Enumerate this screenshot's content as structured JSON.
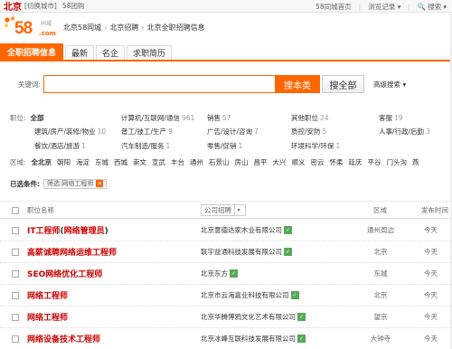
{
  "topbar": {
    "city": "北京",
    "switch_city": "[切换城市]",
    "group": "58团购",
    "home": "58同城首页",
    "history": "浏览记录",
    "search": "搜索"
  },
  "logo": {
    "num": "58",
    "com": ".com",
    "cn": "同城"
  },
  "breadcrumb": [
    "北京58同城",
    "北京招聘",
    "北京全职招聘信息"
  ],
  "tabs": [
    "全职招聘信息",
    "最新",
    "名企",
    "求职简历"
  ],
  "search": {
    "label": "关键词:",
    "value": "",
    "btn_this": "搜本类",
    "btn_all": "搜全部",
    "advanced": "高级搜索"
  },
  "filter": {
    "job_label": "职位:",
    "all": "全部",
    "row1": [
      {
        "t": "计算机/互联网/通信",
        "c": "961"
      },
      {
        "t": "销售",
        "c": "57"
      },
      {
        "t": "其他职位",
        "c": "24"
      },
      {
        "t": "客服",
        "c": "19"
      }
    ],
    "row2": [
      {
        "t": "建筑/房产/装修/物业",
        "c": "10"
      },
      {
        "t": "普工/技工/生产",
        "c": "9"
      },
      {
        "t": "广告/设计/咨询",
        "c": "7"
      },
      {
        "t": "质控/安防",
        "c": "5"
      },
      {
        "t": "人事/行政/后勤",
        "c": "3"
      }
    ],
    "row3": [
      {
        "t": "餐饮/酒店/旅游",
        "c": "1"
      },
      {
        "t": "汽车制造/服务",
        "c": "1"
      },
      {
        "t": "零售/促销",
        "c": "1"
      },
      {
        "t": "环境科学/环保",
        "c": "1"
      }
    ],
    "area_label": "区域:",
    "area_all": "全北京",
    "areas": [
      "朝阳",
      "海淀",
      "东城",
      "西城",
      "崇文",
      "宣武",
      "丰台",
      "通州",
      "石景山",
      "房山",
      "昌平",
      "大兴",
      "顺义",
      "密云",
      "怀柔",
      "延庆",
      "平谷",
      "门头沟",
      "燕"
    ]
  },
  "selected": {
    "label": "已选条件:",
    "chip": "筛选:网络工程师"
  },
  "table": {
    "h_name": "职位名称",
    "h_company": "公司招聘",
    "h_area": "区域",
    "h_time": "发布时间",
    "rows": [
      {
        "parts": [
          [
            "IT",
            "hi"
          ],
          [
            "工程师",
            "hi"
          ],
          [
            "(",
            "n"
          ],
          [
            "网络",
            "hi"
          ],
          [
            "管理员",
            "hi"
          ],
          [
            ")",
            "n"
          ]
        ],
        "company": "北京意德达家木业有限公司",
        "area": "通州周边",
        "time": "今天"
      },
      {
        "parts": [
          [
            "高薪诚聘",
            "hi"
          ],
          [
            "网络",
            "hi"
          ],
          [
            "运维",
            "hi"
          ],
          [
            "工程师",
            "hi"
          ]
        ],
        "company": "联宇益通科技发展有限公司",
        "area": "北京",
        "time": "今天"
      },
      {
        "parts": [
          [
            "SEO",
            "hi"
          ],
          [
            "网络",
            "hi"
          ],
          [
            "优化",
            "hi"
          ],
          [
            "工程师",
            "hi"
          ]
        ],
        "company": "北京东方",
        "area": "东城",
        "time": "今天"
      },
      {
        "parts": [
          [
            "网络",
            "hi"
          ],
          [
            "工程师",
            "hi"
          ]
        ],
        "company": "北京市云海嘉业科技有限公司",
        "area": "北京",
        "time": "今天"
      },
      {
        "parts": [
          [
            "网络",
            "hi"
          ],
          [
            "工程师",
            "hi"
          ]
        ],
        "company": "北京华腾博鸦文化艺术有限公司",
        "area": "望京",
        "time": "今天"
      },
      {
        "parts": [
          [
            "网络",
            "hi"
          ],
          [
            "设备技术",
            "hi"
          ],
          [
            "工程师",
            "hi"
          ]
        ],
        "company": "北京冰峰互联科技发展有限公司",
        "area": "大钟寺",
        "time": "今天"
      }
    ]
  },
  "colors": {
    "accent": "#ff6600",
    "title_red": "#cc0000",
    "vip_green": "#55aa55"
  }
}
